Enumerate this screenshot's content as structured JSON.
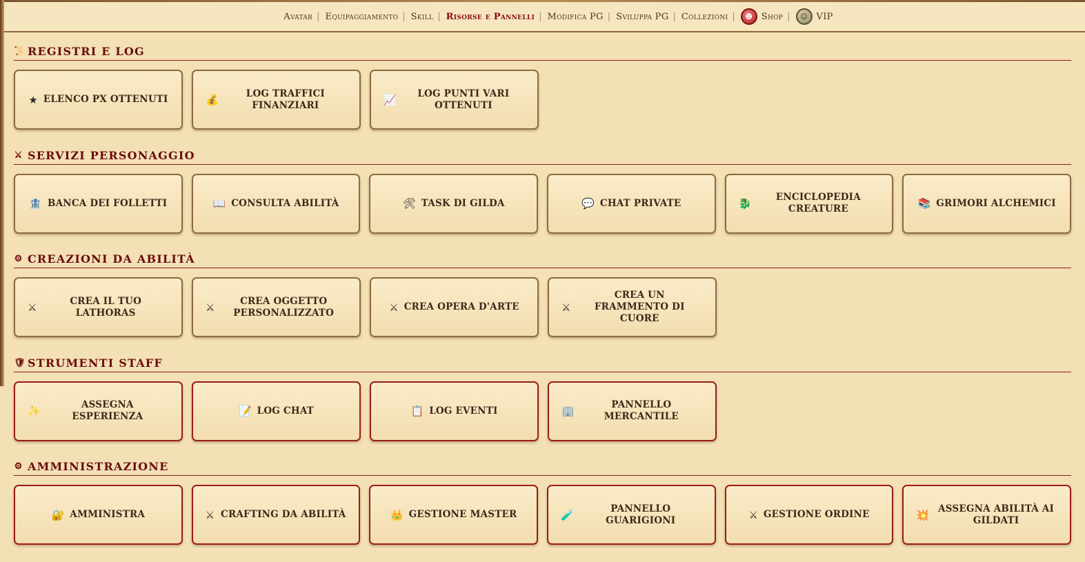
{
  "nav": {
    "items": [
      {
        "label": "Avatar",
        "active": false
      },
      {
        "label": "Equipaggiamento",
        "active": false
      },
      {
        "label": "Skill",
        "active": false
      },
      {
        "label": "Risorse e Pannelli",
        "active": true
      },
      {
        "label": "Modifica PG",
        "active": false
      },
      {
        "label": "Sviluppa PG",
        "active": false
      },
      {
        "label": "Collezioni",
        "active": false
      }
    ],
    "shop_label": "Shop",
    "vip_label": "VIP"
  },
  "sections": [
    {
      "id": "registri",
      "icon": "📜",
      "title": "REGISTRI E LOG",
      "staff": false,
      "cards": [
        {
          "icon": "★",
          "label": "ELENCO PX OTTENUTI"
        },
        {
          "icon": "💰",
          "label": "LOG TRAFFICI FINANZIARI"
        },
        {
          "icon": "📈",
          "label": "LOG PUNTI VARI OTTENUTI"
        }
      ]
    },
    {
      "id": "servizi",
      "icon": "⚔",
      "title": "SERVIZI PERSONAGGIO",
      "staff": false,
      "cards": [
        {
          "icon": "🏦",
          "label": "BANCA DEI FOLLETTI"
        },
        {
          "icon": "📖",
          "label": "CONSULTA ABILITÀ"
        },
        {
          "icon": "🛠",
          "label": "TASK DI GILDA"
        },
        {
          "icon": "💬",
          "label": "CHAT PRIVATE"
        },
        {
          "icon": "🐉",
          "label": "ENCICLOPEDIA CREATURE"
        },
        {
          "icon": "📚",
          "label": "GRIMORI ALCHEMICI"
        }
      ]
    },
    {
      "id": "creazioni",
      "icon": "⚙",
      "title": "CREAZIONI DA ABILITÀ",
      "staff": false,
      "cards": [
        {
          "icon": "⚔",
          "label": "CREA IL TUO LATHORAS"
        },
        {
          "icon": "⚔",
          "label": "CREA OGGETTO PERSONALIZZATO"
        },
        {
          "icon": "⚔",
          "label": "CREA OPERA D'ARTE"
        },
        {
          "icon": "⚔",
          "label": "CREA UN FRAMMENTO DI CUORE"
        }
      ]
    },
    {
      "id": "staff",
      "icon": "🛡",
      "title": "STRUMENTI STAFF",
      "staff": true,
      "cards": [
        {
          "icon": "✨",
          "label": "ASSEGNA ESPERIENZA"
        },
        {
          "icon": "📝",
          "label": "LOG CHAT"
        },
        {
          "icon": "📋",
          "label": "LOG EVENTI"
        },
        {
          "icon": "🏢",
          "label": "PANNELLO MERCANTILE"
        }
      ]
    },
    {
      "id": "amministrazione",
      "icon": "⚙",
      "title": "AMMINISTRAZIONE",
      "staff": true,
      "cards": [
        {
          "icon": "🔐",
          "label": "AMMINISTRA"
        },
        {
          "icon": "⚔",
          "label": "CRAFTING DA ABILITÀ"
        },
        {
          "icon": "👑",
          "label": "GESTIONE MASTER"
        },
        {
          "icon": "🧪",
          "label": "PANNELLO GUARIGIONI"
        },
        {
          "icon": "⚔",
          "label": "GESTIONE ORDINE"
        },
        {
          "icon": "💥",
          "label": "ASSEGNA ABILITÀ AI GILDATI"
        }
      ]
    }
  ]
}
